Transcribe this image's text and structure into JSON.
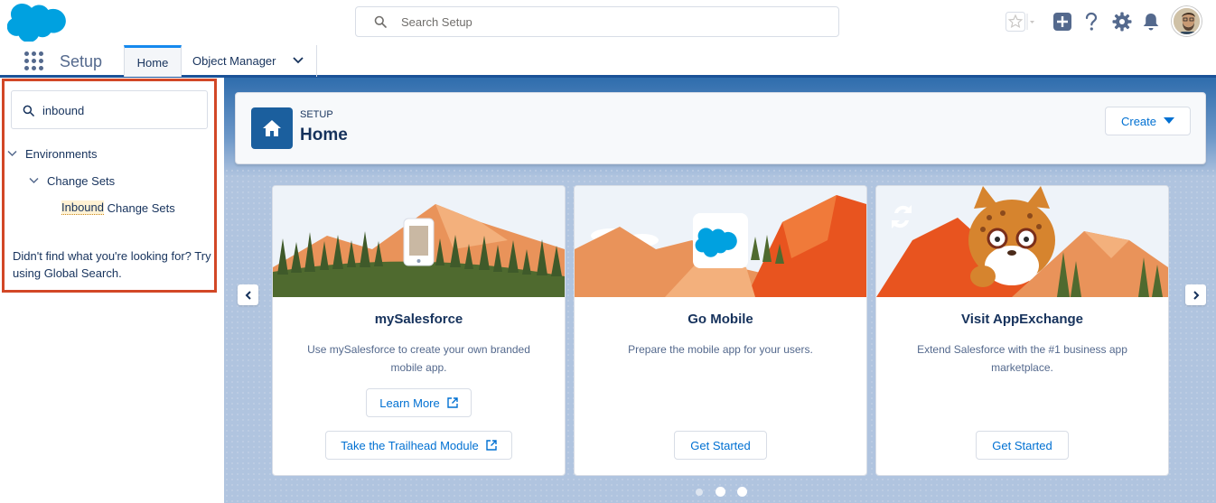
{
  "header": {
    "search_placeholder": "Search Setup",
    "icons": [
      "favorites-star-icon",
      "favorites-dropdown-icon",
      "global-actions-icon",
      "help-icon",
      "setup-gear-icon",
      "notifications-bell-icon",
      "user-avatar"
    ]
  },
  "context_bar": {
    "app_name": "Setup",
    "tabs": [
      {
        "label": "Home",
        "active": true
      },
      {
        "label": "Object Manager",
        "active": false
      }
    ]
  },
  "sidebar": {
    "quickfind_value": "inbound",
    "tree": {
      "environments": "Environments",
      "change_sets": "Change Sets",
      "item_match": "Inbound",
      "item_rest": " Change Sets"
    },
    "help_text": "Didn't find what you're looking for? Try using Global Search."
  },
  "page_header": {
    "eyebrow": "SETUP",
    "title": "Home",
    "create_label": "Create"
  },
  "cards": [
    {
      "title": "mySalesforce",
      "description": "Use mySalesforce to create your own branded mobile app.",
      "button1": "Learn More",
      "button2": "Take the Trailhead Module"
    },
    {
      "title": "Go Mobile",
      "description": "Prepare the mobile app for your users.",
      "button": "Get Started"
    },
    {
      "title": "Visit AppExchange",
      "description": "Extend Salesforce with the #1 business app marketplace.",
      "button": "Get Started"
    }
  ],
  "carousel": {
    "pages": 3,
    "active_page": 2
  },
  "colors": {
    "brand_blue": "#00a1e0",
    "link_blue": "#0070d2",
    "highlight_border": "#d24726",
    "header_icon_bg": "#1b5f9e"
  }
}
